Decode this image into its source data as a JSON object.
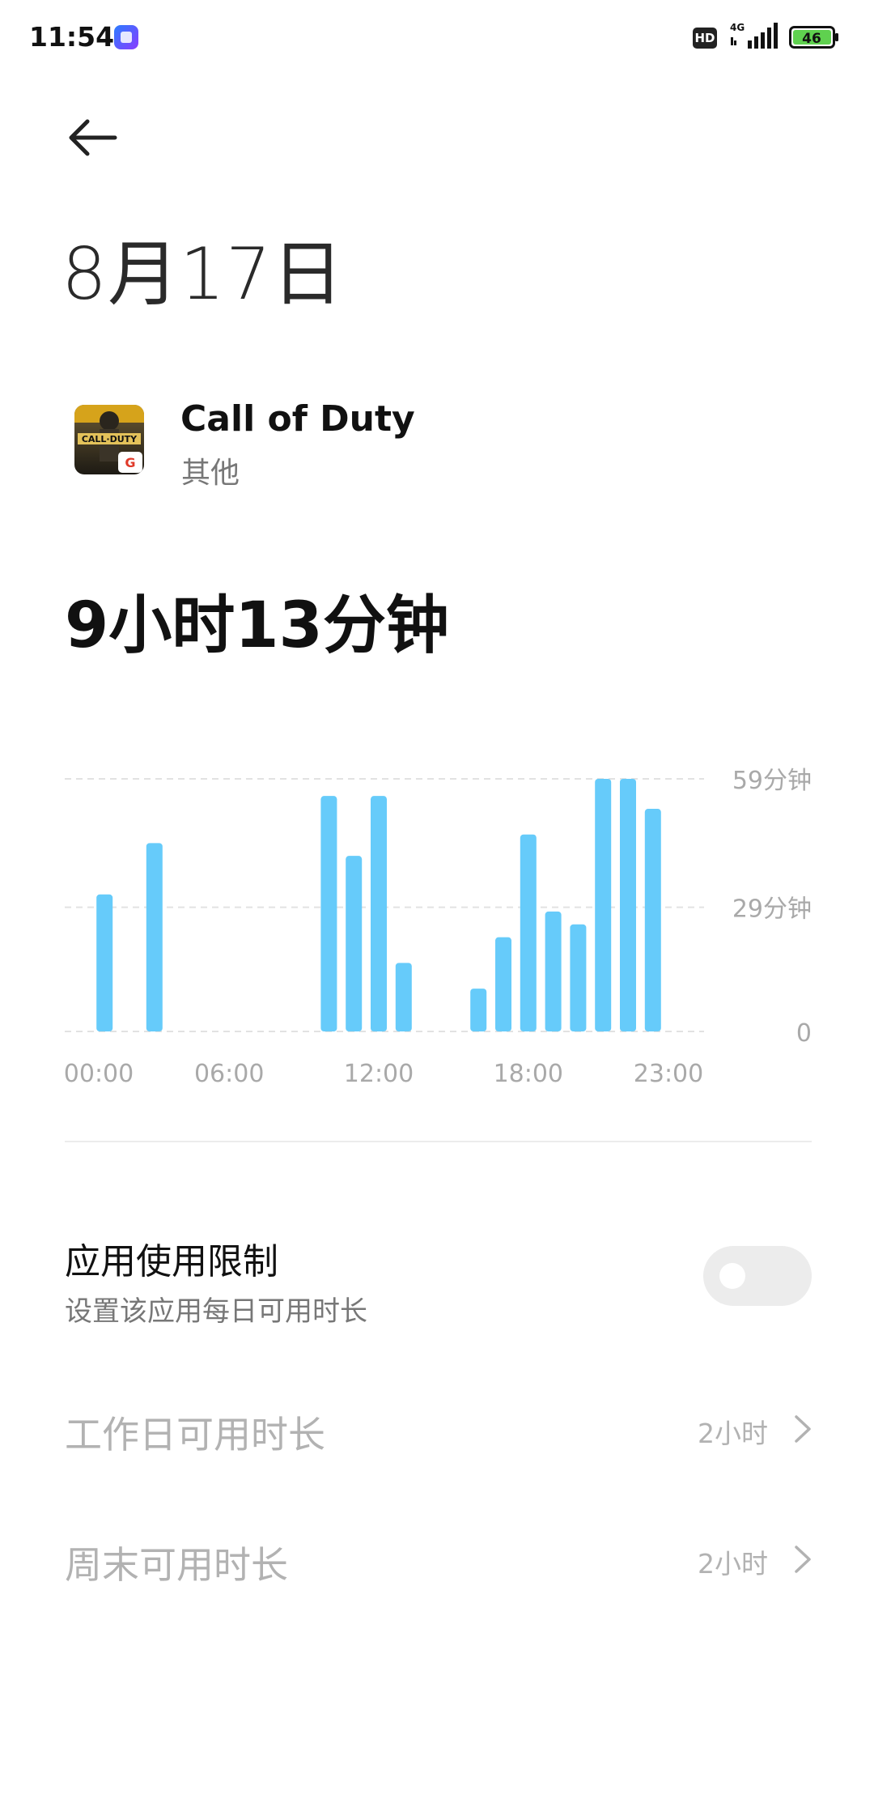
{
  "status_bar": {
    "time": "11:54",
    "hd": "HD",
    "network": "4G",
    "battery": "46"
  },
  "header": {
    "back_icon": "arrow-left-icon",
    "date": "8月17日"
  },
  "app": {
    "name": "Call of Duty",
    "category": "其他",
    "icon": "call-of-duty-app-icon"
  },
  "usage": {
    "total": "9小时13分钟"
  },
  "chart_data": {
    "type": "bar",
    "x": [
      0,
      1,
      2,
      3,
      4,
      5,
      6,
      7,
      8,
      9,
      10,
      11,
      12,
      13,
      14,
      15,
      16,
      17,
      18,
      19,
      20,
      21,
      22,
      23
    ],
    "x_tick_labels": [
      "00:00",
      "06:00",
      "12:00",
      "18:00",
      "23:00"
    ],
    "values": [
      0,
      32,
      0,
      44,
      0,
      0,
      0,
      0,
      0,
      0,
      55,
      41,
      55,
      16,
      0,
      0,
      10,
      22,
      46,
      28,
      25,
      59,
      59,
      52
    ],
    "unit": "分钟",
    "ylim": [
      0,
      59
    ],
    "y_tick_labels": [
      "59分钟",
      "29分钟",
      "0"
    ],
    "grid": true,
    "color": "#66cbfa"
  },
  "limit": {
    "title": "应用使用限制",
    "subtitle": "设置该应用每日可用时长",
    "enabled": false
  },
  "rows": [
    {
      "label": "工作日可用时长",
      "value": "2小时"
    },
    {
      "label": "周末可用时长",
      "value": "2小时"
    }
  ],
  "colors": {
    "bar": "#66cbfa",
    "disabled_text": "#b2b2b2"
  }
}
